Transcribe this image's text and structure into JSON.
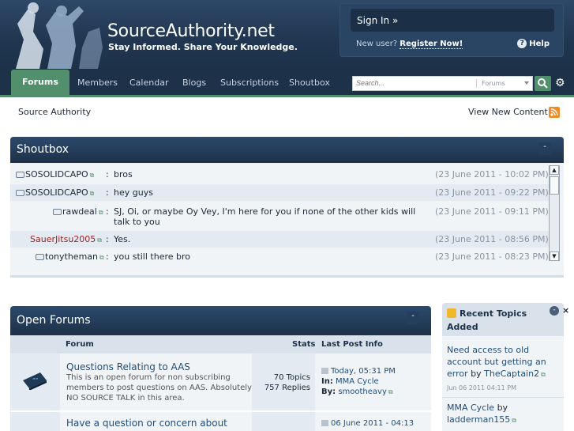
{
  "site": {
    "title": "SourceAuthority.net",
    "tagline": "Stay Informed. Share Your Knowledge."
  },
  "account": {
    "signin_label": "Sign In »",
    "newuser_prefix": "New user?",
    "register_label": "Register Now!",
    "help_label": "Help"
  },
  "nav": {
    "tabs": [
      "Forums",
      "Members",
      "Calendar",
      "Blogs",
      "Subscriptions",
      "Shoutbox"
    ],
    "search_placeholder": "Search...",
    "search_scope": "Forums"
  },
  "breadcrumb": {
    "home": "Source Authority",
    "view_new": "View New Content"
  },
  "shoutbox": {
    "title": "Shoutbox",
    "collapse": "-",
    "rows": [
      {
        "user": "SOSOLIDCAPO",
        "msg": "bros",
        "time": "(23 June 2011 - 10:02 PM)"
      },
      {
        "user": "SOSOLIDCAPO",
        "msg": "hey guys",
        "time": "(23 June 2011 - 09:22 PM)"
      },
      {
        "user": "rawdeal",
        "msg": "SJ, Oi, or maybe Oy Vey, I'm here for you if none of the other kids will talk to you",
        "time": "(23 June 2011 - 09:11 PM)"
      },
      {
        "user": "SauerJitsu2005",
        "msg": "Yes.",
        "time": "(23 June 2011 - 08:56 PM)"
      },
      {
        "user": "tonytheman",
        "msg": "you still there bro",
        "time": "(23 June 2011 - 08:23 PM)"
      }
    ]
  },
  "forums": {
    "title": "Open Forums",
    "collapse": "-",
    "cols": {
      "forum": "Forum",
      "stats": "Stats",
      "last": "Last Post Info"
    },
    "rows": [
      {
        "name": "Questions Relating to AAS",
        "desc": "This is an open forum for non subscribing members to post questions on AAS. Absolutely NO SOURCE TALK in this area.",
        "topics": "70 Topics",
        "replies": "757 Replies",
        "last_time": "Today, 05:31 PM",
        "in_label": "In:",
        "in_topic": "MMA Cycle",
        "by_label": "By:",
        "by_user": "smootheavy"
      },
      {
        "name": "Have a question or concern about",
        "last_time": "06 June 2011 - 04:13"
      }
    ]
  },
  "recent": {
    "title": "Recent Topics Added",
    "minimize": "-",
    "close": "×",
    "items": [
      {
        "topic": "Need access to old account but getting an error",
        "by": "by",
        "user": "TheCaptain2",
        "date": "Jun 06 2011 04:11 PM"
      },
      {
        "topic": "MMA Cycle",
        "by": "by",
        "user": "ladderman155"
      }
    ]
  },
  "colors": {
    "navy": "#1d3149",
    "green": "#528f6c",
    "link": "#1f4d7a",
    "alert": "#9c1f1f"
  }
}
